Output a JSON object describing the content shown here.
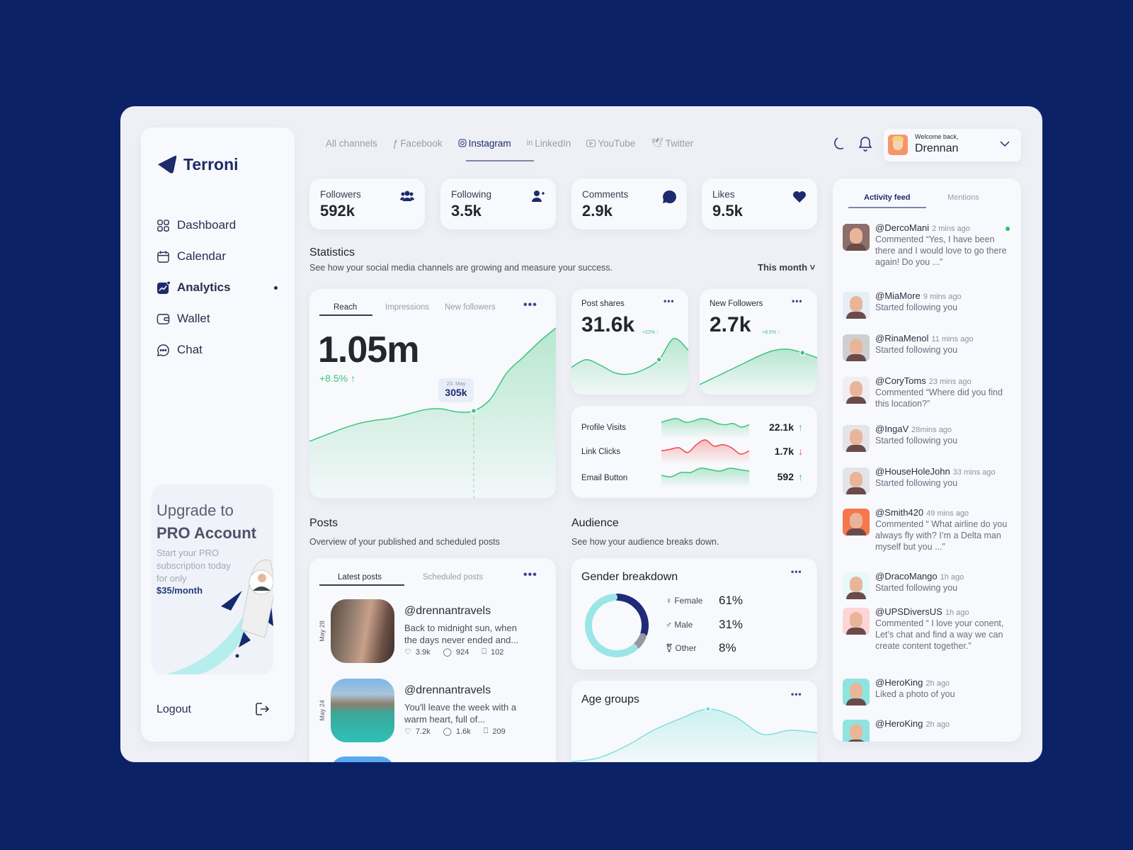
{
  "brand": {
    "name": "Terroni",
    "color": "#1d2a6b"
  },
  "sidebar": {
    "items": [
      {
        "label": "Dashboard",
        "icon": "grid-icon"
      },
      {
        "label": "Calendar",
        "icon": "calendar-icon"
      },
      {
        "label": "Analytics",
        "icon": "analytics-icon",
        "active": true
      },
      {
        "label": "Wallet",
        "icon": "wallet-icon"
      },
      {
        "label": "Chat",
        "icon": "chat-icon"
      }
    ],
    "upgrade": {
      "line1": "Upgrade to",
      "line2": "PRO Account",
      "text": "Start your PRO subscription today for only",
      "price": "$35/month"
    },
    "logout": "Logout"
  },
  "channels": [
    {
      "label": "All channels"
    },
    {
      "label": "Facebook",
      "icon": "facebook-icon"
    },
    {
      "label": "Instagram",
      "icon": "instagram-icon",
      "active": true
    },
    {
      "label": "LinkedIn",
      "icon": "linkedin-icon"
    },
    {
      "label": "YouTube",
      "icon": "youtube-icon"
    },
    {
      "label": "Twitter",
      "icon": "twitter-icon"
    }
  ],
  "user": {
    "greeting": "Welcome back,",
    "name": "Drennan"
  },
  "stats": [
    {
      "label": "Followers",
      "value": "592k",
      "icon": "users-icon"
    },
    {
      "label": "Following",
      "value": "3.5k",
      "icon": "user-plus-icon"
    },
    {
      "label": "Comments",
      "value": "2.9k",
      "icon": "comment-icon"
    },
    {
      "label": "Likes",
      "value": "9.5k",
      "icon": "heart-icon"
    }
  ],
  "statistics": {
    "title": "Statistics",
    "subtitle": "See how your social media channels are growing and measure your success.",
    "period": "This month"
  },
  "reach": {
    "tabs": [
      "Reach",
      "Impressions",
      "New followers"
    ],
    "value": "1.05m",
    "change": "+8.5%",
    "tooltip_date": "23. May",
    "tooltip_value": "305k",
    "series": [
      20,
      26,
      32,
      37,
      40,
      42,
      46,
      50,
      51,
      48,
      49,
      60,
      85,
      100,
      115,
      128
    ]
  },
  "post_shares": {
    "title": "Post shares",
    "value": "31.6k",
    "change": "+22%",
    "series": [
      40,
      48,
      42,
      34,
      33,
      38,
      48,
      70,
      58
    ]
  },
  "new_followers": {
    "title": "New Followers",
    "value": "2.7k",
    "change": "+8.5%",
    "series": [
      10,
      20,
      30,
      40,
      50,
      58,
      60,
      55,
      48
    ]
  },
  "metrics": [
    {
      "label": "Profile Visits",
      "value": "22.1k",
      "trend": "up",
      "color": "#3dc47e",
      "series": [
        6,
        8,
        9,
        6,
        7,
        9,
        8,
        5,
        4,
        5,
        2,
        4
      ]
    },
    {
      "label": "Link Clicks",
      "value": "1.7k",
      "trend": "down",
      "color": "#f04a4a",
      "series": [
        5,
        6,
        7,
        4,
        9,
        12,
        8,
        9,
        7,
        3,
        5
      ]
    },
    {
      "label": "Email Button",
      "value": "592",
      "trend": "up",
      "color": "#3dc47e",
      "series": [
        3,
        2,
        5,
        5,
        8,
        7,
        6,
        8,
        7,
        6
      ]
    }
  ],
  "posts": {
    "title": "Posts",
    "subtitle": "Overview of your published and scheduled posts",
    "tabs": [
      "Latest posts",
      "Scheduled posts"
    ],
    "items": [
      {
        "date": "May 28",
        "user": "@drennantravels",
        "caption": "Back to midnight sun, when the days never ended and...",
        "likes": "3.9k",
        "comments": "924",
        "saves": "102"
      },
      {
        "date": "May 24",
        "user": "@drennantravels",
        "caption": "You'll leave the week with a warm heart, full of...",
        "likes": "7.2k",
        "comments": "1.6k",
        "saves": "209"
      }
    ]
  },
  "audience": {
    "title": "Audience",
    "subtitle": "See how your audience breaks down.",
    "gender": {
      "title": "Gender breakdown",
      "items": [
        {
          "label": "Female",
          "pct": "61%",
          "value": 61,
          "color": "#9ae6e6"
        },
        {
          "label": "Male",
          "pct": "31%",
          "value": 31,
          "color": "#1f2a78"
        },
        {
          "label": "Other",
          "pct": "8%",
          "value": 8,
          "color": "#9497a4"
        }
      ]
    },
    "age": {
      "title": "Age groups",
      "series": [
        5,
        10,
        25,
        45,
        60,
        72,
        62,
        40,
        45,
        42
      ]
    }
  },
  "feed": {
    "tabs": [
      "Activity feed",
      "Mentions"
    ],
    "items": [
      {
        "user": "@DercoMani",
        "time": "2 mins ago",
        "text": "Commented “Yes, I have been there and I would love to go there again! Do you ...”",
        "bg": "#8c6e6a",
        "unread": true
      },
      {
        "user": "@MiaMore",
        "time": "9 mins ago",
        "text": "Started following you",
        "bg": "#e6eef8"
      },
      {
        "user": "@RinaMenol",
        "time": "11 mins ago",
        "text": "Started following you",
        "bg": "#cfcfd2"
      },
      {
        "user": "@CoryToms",
        "time": "23 mins ago",
        "text": "Commented “Where did you find this location?”",
        "bg": "#f0eef2"
      },
      {
        "user": "@IngaV",
        "time": "28mins ago",
        "text": "Started following you",
        "bg": "#e4e4e6"
      },
      {
        "user": "@HouseHoleJohn",
        "time": "33 mins ago",
        "text": "Started following you",
        "bg": "#e3e4ea"
      },
      {
        "user": "@Smith420",
        "time": "49 mins ago",
        "text": "Commented “ What airline do you always fly with? I’m a Delta man myself but you ...”",
        "bg": "#f6784a"
      },
      {
        "user": "@DracoMango",
        "time": "1h ago",
        "text": "Started following you",
        "bg": "#e6f8f8"
      },
      {
        "user": "@UPSDiversUS",
        "time": "1h ago",
        "text": "Commented “ I love your conent, Let’s chat and find a way we can create content together.”",
        "bg": "#fcd6d6"
      },
      {
        "user": "@HeroKing",
        "time": "2h ago",
        "text": "Liked a photo of you",
        "bg": "#8ee4e0"
      },
      {
        "user": "@HeroKing",
        "time": "2h ago",
        "text": "",
        "bg": "#8ee4e0"
      }
    ]
  }
}
